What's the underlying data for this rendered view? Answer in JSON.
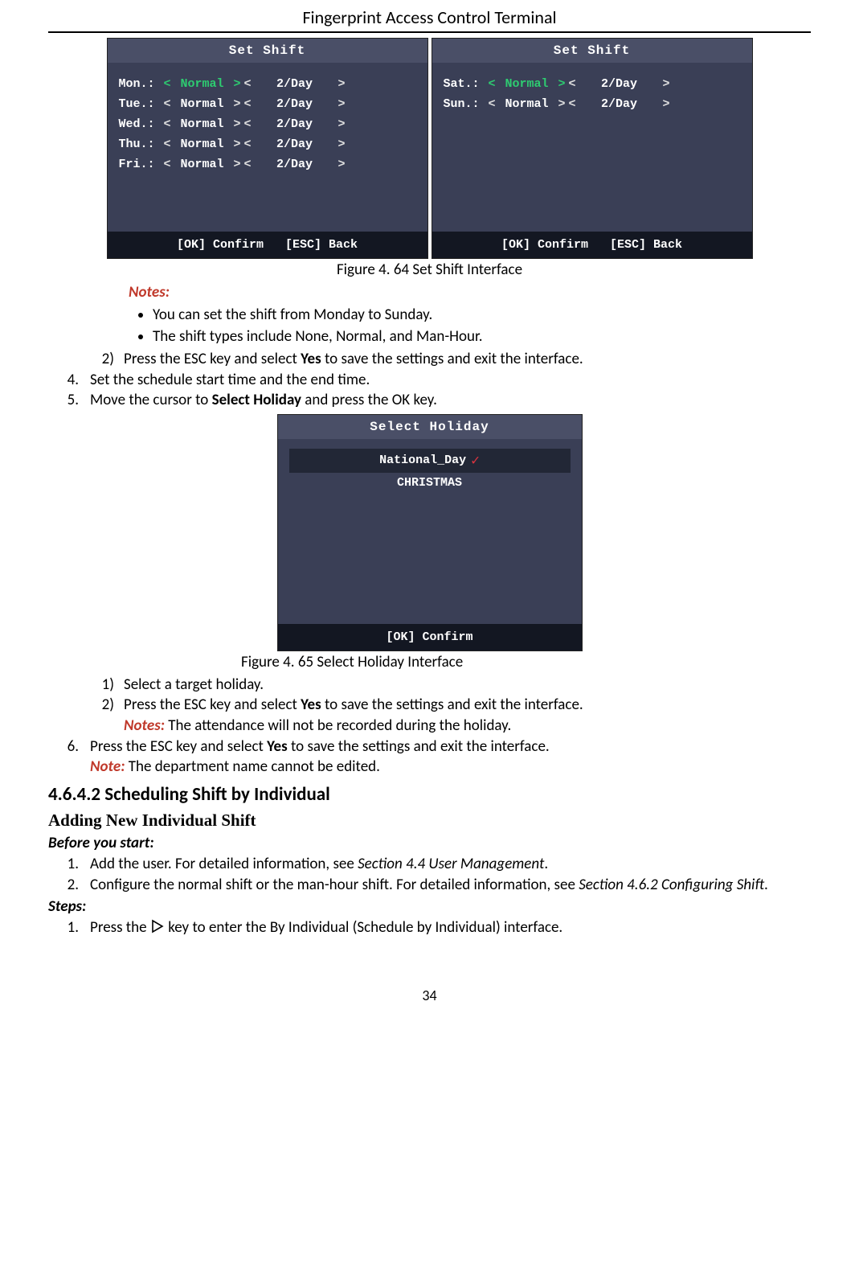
{
  "doc_title": "Fingerprint Access Control Terminal",
  "page_number": "34",
  "screen_a": {
    "title": "Set Shift",
    "rows": [
      {
        "day": "Mon.:",
        "type": "Normal",
        "freq": "2/Day",
        "sel": true
      },
      {
        "day": "Tue.:",
        "type": "Normal",
        "freq": "2/Day",
        "sel": false
      },
      {
        "day": "Wed.:",
        "type": "Normal",
        "freq": "2/Day",
        "sel": false
      },
      {
        "day": "Thu.:",
        "type": "Normal",
        "freq": "2/Day",
        "sel": false
      },
      {
        "day": "Fri.:",
        "type": "Normal",
        "freq": "2/Day",
        "sel": false
      }
    ],
    "footer": "[OK] Confirm   [ESC] Back"
  },
  "screen_b": {
    "title": "Set Shift",
    "rows": [
      {
        "day": "Sat.:",
        "type": "Normal",
        "freq": "2/Day",
        "sel": true
      },
      {
        "day": "Sun.:",
        "type": "Normal",
        "freq": "2/Day",
        "sel": false
      }
    ],
    "footer": "[OK] Confirm   [ESC] Back"
  },
  "fig1": "Figure 4. 64 Set Shift Interface",
  "notes_label": "Notes:",
  "note_items": [
    "You can set the shift from Monday to Sunday.",
    "The shift types include None, Normal, and Man-Hour."
  ],
  "step2_2_pre": "Press the ESC key and select ",
  "step2_2_bold": "Yes",
  "step2_2_post": " to save the settings and exit the interface.",
  "step4": "Set the schedule start time and the end time.",
  "step5_pre": "Move the cursor to ",
  "step5_bold": "Select Holiday",
  "step5_post": " and press the OK key.",
  "screen_c": {
    "title": "Select Holiday",
    "items": [
      {
        "label": "National_Day",
        "selected": true
      },
      {
        "label": "CHRISTMAS",
        "selected": false
      }
    ],
    "footer": "[OK] Confirm"
  },
  "fig2": "Figure 4. 65 Select Holiday Interface",
  "substep1": "Select a target holiday.",
  "substep2_pre": "Press the ESC key and select ",
  "substep2_bold": "Yes",
  "substep2_post": " to save the settings and exit the interface.",
  "subnotes_label": "Notes: ",
  "subnotes_text": "The attendance will not be recorded during the holiday.",
  "step6_pre": "Press the ESC key and select ",
  "step6_bold": "Yes",
  "step6_post": " to save the settings and exit the interface.",
  "note_single_label": "Note: ",
  "note_single_text": "The department name cannot be edited.",
  "section_heading": "4.6.4.2 Scheduling Shift by Individual",
  "subsection_heading": "Adding New Individual Shift",
  "before_you_start": "Before you start:",
  "bys_1_pre": "Add the user. For detailed information, see ",
  "bys_1_italic": "Section 4.4 User Management",
  "bys_1_post": ".",
  "bys_2_pre": "Configure the normal shift or the man-hour shift. For detailed information, see ",
  "bys_2_italic": "Section 4.6.2 Configuring Shift",
  "bys_2_post": ".",
  "steps_label": "Steps:",
  "steps_1_pre": "Press the ",
  "steps_1_post": " key to enter the By Individual (Schedule by Individual) interface.",
  "nums": {
    "n2)": "2)",
    "n4": "4.",
    "n5": "5.",
    "n1)": "1)",
    "n6": "6.",
    "n1": "1.",
    "n2": "2."
  }
}
